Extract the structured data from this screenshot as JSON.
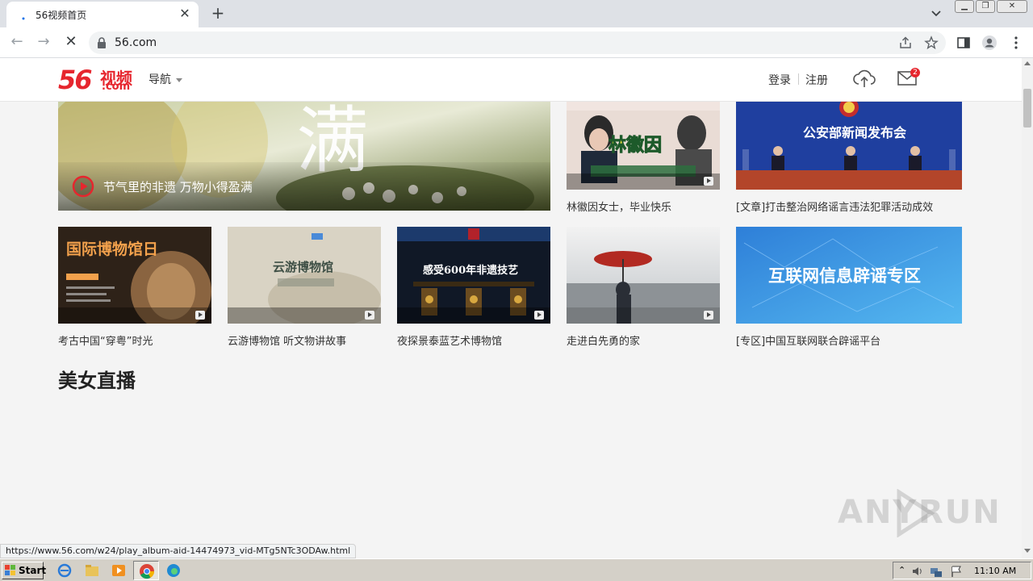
{
  "browser": {
    "tab_title": "56视频首页",
    "url": "56.com",
    "status_url": "https://www.56.com/w24/play_album-aid-14474973_vid-MTg5NTc3ODAw.html"
  },
  "header": {
    "logo_num": "56",
    "logo_cn": "视频",
    "logo_com": ".com",
    "nav_label": "导航",
    "login": "登录",
    "register": "注册",
    "mail_badge": "2"
  },
  "featured": {
    "title": "节气里的非遗 万物小得盈满",
    "overlay_text": "满"
  },
  "row1": [
    {
      "caption": "林徽因女士，毕业快乐",
      "overlay": "林徽因"
    },
    {
      "caption": "[文章]打击整治网络谣言违法犯罪活动成效",
      "overlay": "公安部新闻发布会"
    }
  ],
  "row2": [
    {
      "caption": "考古中国“穿粤”时光",
      "overlay": "国际博物馆日"
    },
    {
      "caption": "云游博物馆 听文物讲故事",
      "overlay": "云游博物馆"
    },
    {
      "caption": "夜探景泰蓝艺术博物馆",
      "overlay": "感受600年非遗技艺"
    },
    {
      "caption": "走进白先勇的家",
      "overlay": ""
    },
    {
      "caption": "[专区]中国互联网联合辟谣平台",
      "overlay": "互联网信息辟谣专区"
    }
  ],
  "section_title": "美女直播",
  "watermark": "ANY RUN",
  "taskbar": {
    "start": "Start",
    "clock": "11:10 AM"
  },
  "colors": {
    "brand": "#e6262e",
    "chrome_bg": "#dee1e6"
  }
}
